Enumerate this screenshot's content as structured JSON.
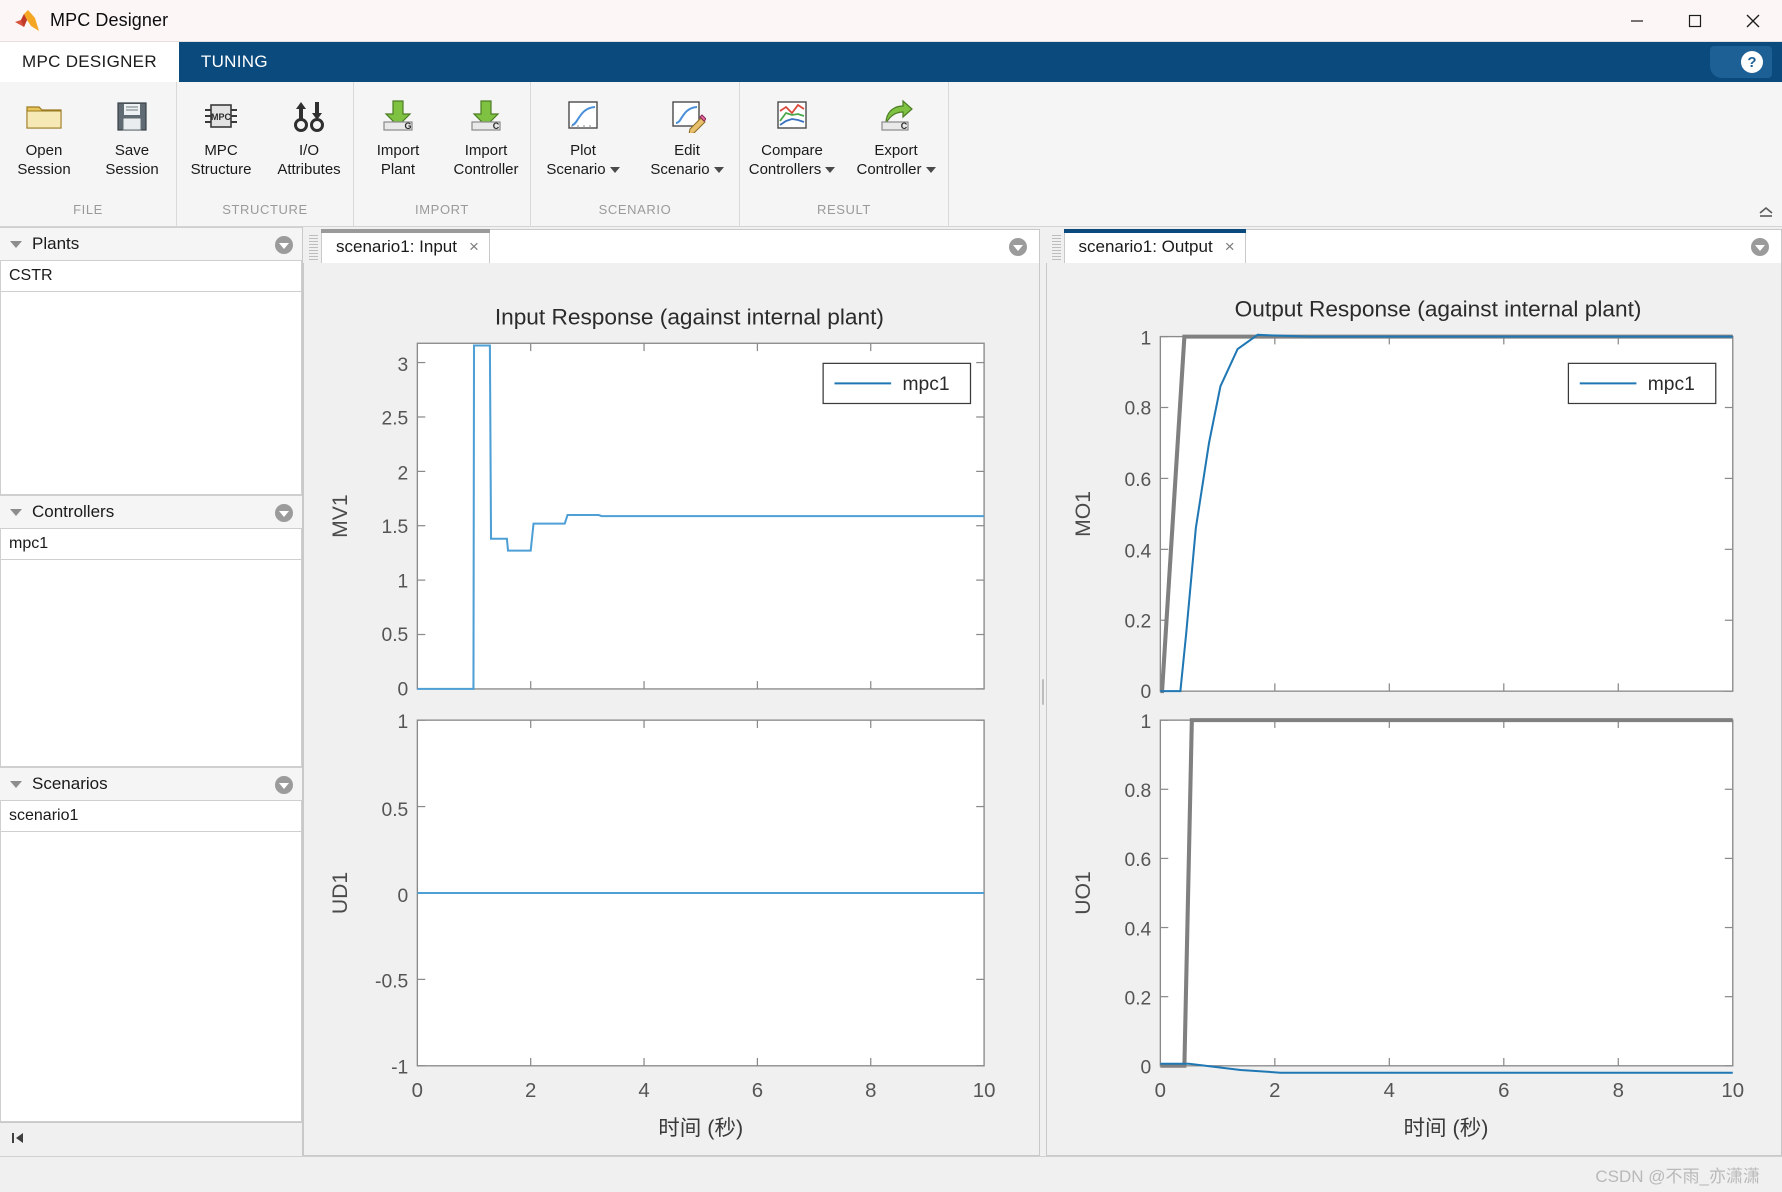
{
  "window": {
    "title": "MPC Designer",
    "logo_icon": "matlab-logo-icon",
    "minimize_label": "─",
    "maximize_label": "□",
    "close_label": "✕"
  },
  "ribbon_tabs": [
    {
      "label": "MPC DESIGNER",
      "active": true
    },
    {
      "label": "TUNING",
      "active": false
    }
  ],
  "help": {
    "icon": "help-question-icon",
    "label": "?"
  },
  "ribbon": {
    "collapse_icon": "collapse-ribbon-icon",
    "groups": [
      {
        "name": "FILE",
        "label": "FILE",
        "items": [
          {
            "label": "Open\nSession",
            "icon": "open-folder-icon",
            "has_caret": false
          },
          {
            "label": "Save\nSession",
            "icon": "save-floppy-icon",
            "has_caret": false
          }
        ]
      },
      {
        "name": "STRUCTURE",
        "label": "STRUCTURE",
        "items": [
          {
            "label": "MPC\nStructure",
            "icon": "mpc-chip-icon",
            "has_caret": false
          },
          {
            "label": "I/O\nAttributes",
            "icon": "io-arrows-icon",
            "has_caret": false
          }
        ]
      },
      {
        "name": "IMPORT",
        "label": "IMPORT",
        "items": [
          {
            "label": "Import\nPlant",
            "icon": "import-plant-icon",
            "has_caret": false
          },
          {
            "label": "Import\nController",
            "icon": "import-controller-icon",
            "has_caret": false
          }
        ]
      },
      {
        "name": "SCENARIO",
        "label": "SCENARIO",
        "items": [
          {
            "label": "Plot\nScenario",
            "icon": "plot-scenario-icon",
            "has_caret": true
          },
          {
            "label": "Edit\nScenario",
            "icon": "edit-scenario-icon",
            "has_caret": true
          }
        ]
      },
      {
        "name": "RESULT",
        "label": "RESULT",
        "items": [
          {
            "label": "Compare\nControllers",
            "icon": "compare-controllers-icon",
            "has_caret": true
          },
          {
            "label": "Export\nController",
            "icon": "export-controller-icon",
            "has_caret": true
          }
        ]
      }
    ]
  },
  "sidebar": {
    "panels": [
      {
        "title": "Plants",
        "twisty_icon": "chevron-down-icon",
        "menu_icon": "panel-menu-icon",
        "items": [
          "CSTR"
        ]
      },
      {
        "title": "Controllers",
        "twisty_icon": "chevron-down-icon",
        "menu_icon": "panel-menu-icon",
        "items": [
          "mpc1"
        ]
      },
      {
        "title": "Scenarios",
        "twisty_icon": "chevron-down-icon",
        "menu_icon": "panel-menu-icon",
        "items": [
          "scenario1"
        ]
      }
    ],
    "footer_icon": "go-to-first-icon"
  },
  "documents": [
    {
      "tab_label": "scenario1: Input",
      "close_label": "×",
      "active": false,
      "menu_icon": "panel-menu-icon"
    },
    {
      "tab_label": "scenario1: Output",
      "close_label": "×",
      "active": true,
      "menu_icon": "panel-menu-icon"
    }
  ],
  "statusbar": {
    "watermark": "CSDN @不雨_亦潇潇"
  },
  "colors": {
    "accent_blue": "#0a4a7d",
    "series_blue": "#4d9fd6",
    "series_blue_dark": "#1f77b4",
    "reference_gray": "#808080",
    "plot_bg": "#ffffff",
    "panel_bg": "#f0f0f0"
  },
  "chart_data": [
    {
      "id": "mv1",
      "type": "line",
      "title": "Input Response (against internal plant)",
      "xlabel": "时间 (秒)",
      "ylabel": "MV1",
      "xlim": [
        0,
        10
      ],
      "ylim": [
        0,
        3.2
      ],
      "xticks": [
        0,
        2,
        4,
        6,
        8,
        10
      ],
      "xticklabels": [
        "0",
        "2",
        "4",
        "6",
        "8",
        "10"
      ],
      "yticks": [
        0,
        0.5,
        1,
        1.5,
        2,
        2.5,
        3
      ],
      "yticklabels": [
        "0",
        "0.5",
        "1",
        "1.5",
        "2",
        "2.5",
        "3"
      ],
      "grid": false,
      "legend": {
        "entries": [
          "mpc1"
        ],
        "position": "top-right"
      },
      "series": [
        {
          "name": "mpc1",
          "color": "#4d9fd6",
          "style": "stairs",
          "x": [
            0,
            0.99,
            1.0,
            1.28,
            1.3,
            1.58,
            1.6,
            2.0,
            2.05,
            2.6,
            2.65,
            3.2,
            3.25,
            10
          ],
          "y": [
            0,
            0,
            3.18,
            3.18,
            1.39,
            1.39,
            1.28,
            1.28,
            1.53,
            1.53,
            1.61,
            1.61,
            1.6,
            1.6
          ]
        }
      ]
    },
    {
      "id": "ud1",
      "type": "line",
      "title": "",
      "xlabel": "时间 (秒)",
      "ylabel": "UD1",
      "xlim": [
        0,
        10
      ],
      "ylim": [
        -1,
        1
      ],
      "xticks": [
        0,
        2,
        4,
        6,
        8,
        10
      ],
      "xticklabels": [
        "0",
        "2",
        "4",
        "6",
        "8",
        "10"
      ],
      "yticks": [
        -1,
        -0.5,
        0,
        0.5,
        1
      ],
      "yticklabels": [
        "-1",
        "-0.5",
        "0",
        "0.5",
        "1"
      ],
      "grid": false,
      "legend": null,
      "series": [
        {
          "name": "mpc1",
          "color": "#4d9fd6",
          "style": "line",
          "x": [
            0,
            10
          ],
          "y": [
            0,
            0
          ]
        }
      ]
    },
    {
      "id": "mo1",
      "type": "line",
      "title": "Output Response (against internal plant)",
      "xlabel": "时间 (秒)",
      "ylabel": "MO1",
      "xlim": [
        0,
        10
      ],
      "ylim": [
        0,
        1
      ],
      "xticks": [
        0,
        2,
        4,
        6,
        8,
        10
      ],
      "xticklabels": [
        "0",
        "2",
        "4",
        "6",
        "8",
        "10"
      ],
      "yticks": [
        0,
        0.2,
        0.4,
        0.6,
        0.8,
        1
      ],
      "yticklabels": [
        "0",
        "0.2",
        "0.4",
        "0.6",
        "0.8",
        "1"
      ],
      "grid": false,
      "legend": {
        "entries": [
          "mpc1"
        ],
        "position": "top-right"
      },
      "series": [
        {
          "name": "reference",
          "color": "#808080",
          "style": "line",
          "width": 3.5,
          "x": [
            0,
            0.03,
            0.42,
            10
          ],
          "y": [
            0,
            0,
            1,
            1
          ]
        },
        {
          "name": "mpc1",
          "color": "#1f77b4",
          "style": "line",
          "x": [
            0,
            0.35,
            0.45,
            0.62,
            0.85,
            1.05,
            1.35,
            1.7,
            2.0,
            2.6,
            10
          ],
          "y": [
            0,
            0,
            0.16,
            0.46,
            0.7,
            0.86,
            0.965,
            1.005,
            1.003,
            1.0,
            1.0
          ]
        }
      ]
    },
    {
      "id": "uo1",
      "type": "line",
      "title": "",
      "xlabel": "时间 (秒)",
      "ylabel": "UO1",
      "xlim": [
        0,
        10
      ],
      "ylim": [
        0,
        1
      ],
      "xticks": [
        0,
        2,
        4,
        6,
        8,
        10
      ],
      "xticklabels": [
        "0",
        "2",
        "4",
        "6",
        "8",
        "10"
      ],
      "yticks": [
        0,
        0.2,
        0.4,
        0.6,
        0.8,
        1
      ],
      "yticklabels": [
        "0",
        "0.2",
        "0.4",
        "0.6",
        "0.8",
        "1"
      ],
      "grid": false,
      "legend": null,
      "series": [
        {
          "name": "reference",
          "color": "#808080",
          "style": "line",
          "width": 3.5,
          "x": [
            0,
            0.42,
            0.55,
            10
          ],
          "y": [
            0,
            0,
            1,
            1
          ]
        },
        {
          "name": "mpc1",
          "color": "#1f77b4",
          "style": "line",
          "x": [
            0,
            0.5,
            1.4,
            2.1,
            10
          ],
          "y": [
            0.006,
            0.006,
            -0.012,
            -0.02,
            -0.02
          ]
        }
      ]
    }
  ]
}
